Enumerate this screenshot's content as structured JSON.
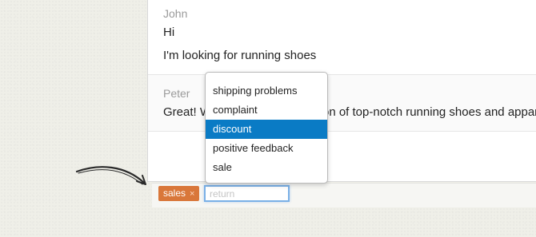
{
  "conversation": {
    "messages": [
      {
        "author": "John",
        "lines": [
          "Hi",
          "I'm looking for running shoes"
        ]
      },
      {
        "author": "Peter",
        "lines": [
          "Great! We have a wide selection of top-notch running shoes and apparel"
        ]
      }
    ]
  },
  "tags": {
    "items": [
      {
        "label": "sales",
        "remove": "×"
      }
    ],
    "input_placeholder": "return",
    "input_value": ""
  },
  "suggestions": {
    "options": [
      "shipping problems",
      "complaint",
      "discount",
      "positive feedback",
      "sale"
    ],
    "selected": "discount"
  },
  "colors": {
    "tag_background": "#d9773a",
    "selection": "#0a7bc5",
    "input_focus": "#7ab0e6"
  }
}
